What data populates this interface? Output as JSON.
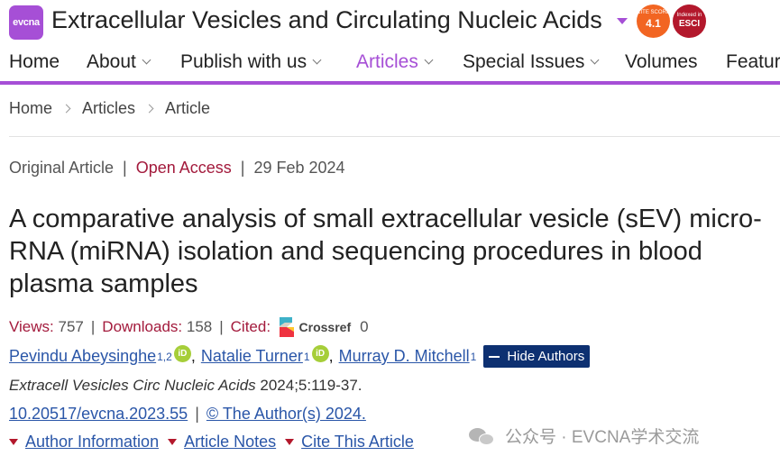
{
  "header": {
    "logo_text": "evcna",
    "journal_title": "Extracellular Vesicles and Circulating Nucleic Acids",
    "cite_badge": {
      "label": "CITE SCORE",
      "value": "4.1",
      "color": "#f26522"
    },
    "esci_badge": {
      "label": "Indexed in",
      "value": "ESCI",
      "color": "#b3182c"
    },
    "accent": "#a64fd6"
  },
  "nav": {
    "items": [
      {
        "label": "Home",
        "has_menu": false
      },
      {
        "label": "About",
        "has_menu": true
      },
      {
        "label": "Publish with us",
        "has_menu": true
      },
      {
        "label": "Articles",
        "has_menu": true,
        "active": true
      },
      {
        "label": "Special Issues",
        "has_menu": true
      },
      {
        "label": "Volumes",
        "has_menu": false
      },
      {
        "label": "Featur",
        "has_menu": false
      }
    ]
  },
  "breadcrumb": [
    "Home",
    "Articles",
    "Article"
  ],
  "article": {
    "type": "Original Article",
    "access": "Open Access",
    "date": "29 Feb 2024",
    "title": "A comparative analysis of small extracellular vesicle (sEV) micro-RNA (miRNA) isolation and sequencing procedures in blood plasma samples",
    "stats": {
      "views_label": "Views:",
      "views": "757",
      "downloads_label": "Downloads:",
      "downloads": "158",
      "cited_label": "Cited:",
      "crossref": "Crossref",
      "cited": "0"
    },
    "authors": [
      {
        "name": "Pevindu Abeysinghe",
        "aff": "1,2",
        "orcid": true
      },
      {
        "name": "Natalie Turner",
        "aff": "1",
        "orcid": true
      },
      {
        "name": "Murray D. Mitchell",
        "aff": "1",
        "orcid": false
      }
    ],
    "hide_authors_label": "Hide Authors",
    "citation_journal": "Extracell Vesicles Circ Nucleic Acids",
    "citation_rest": " 2024;5:119-37.",
    "doi": "10.20517/evcna.2023.55",
    "copyright": "© The Author(s) 2024.",
    "sections": [
      "Author Information",
      "Article Notes",
      "Cite This Article"
    ]
  },
  "watermark": "公众号 · EVCNA学术交流"
}
